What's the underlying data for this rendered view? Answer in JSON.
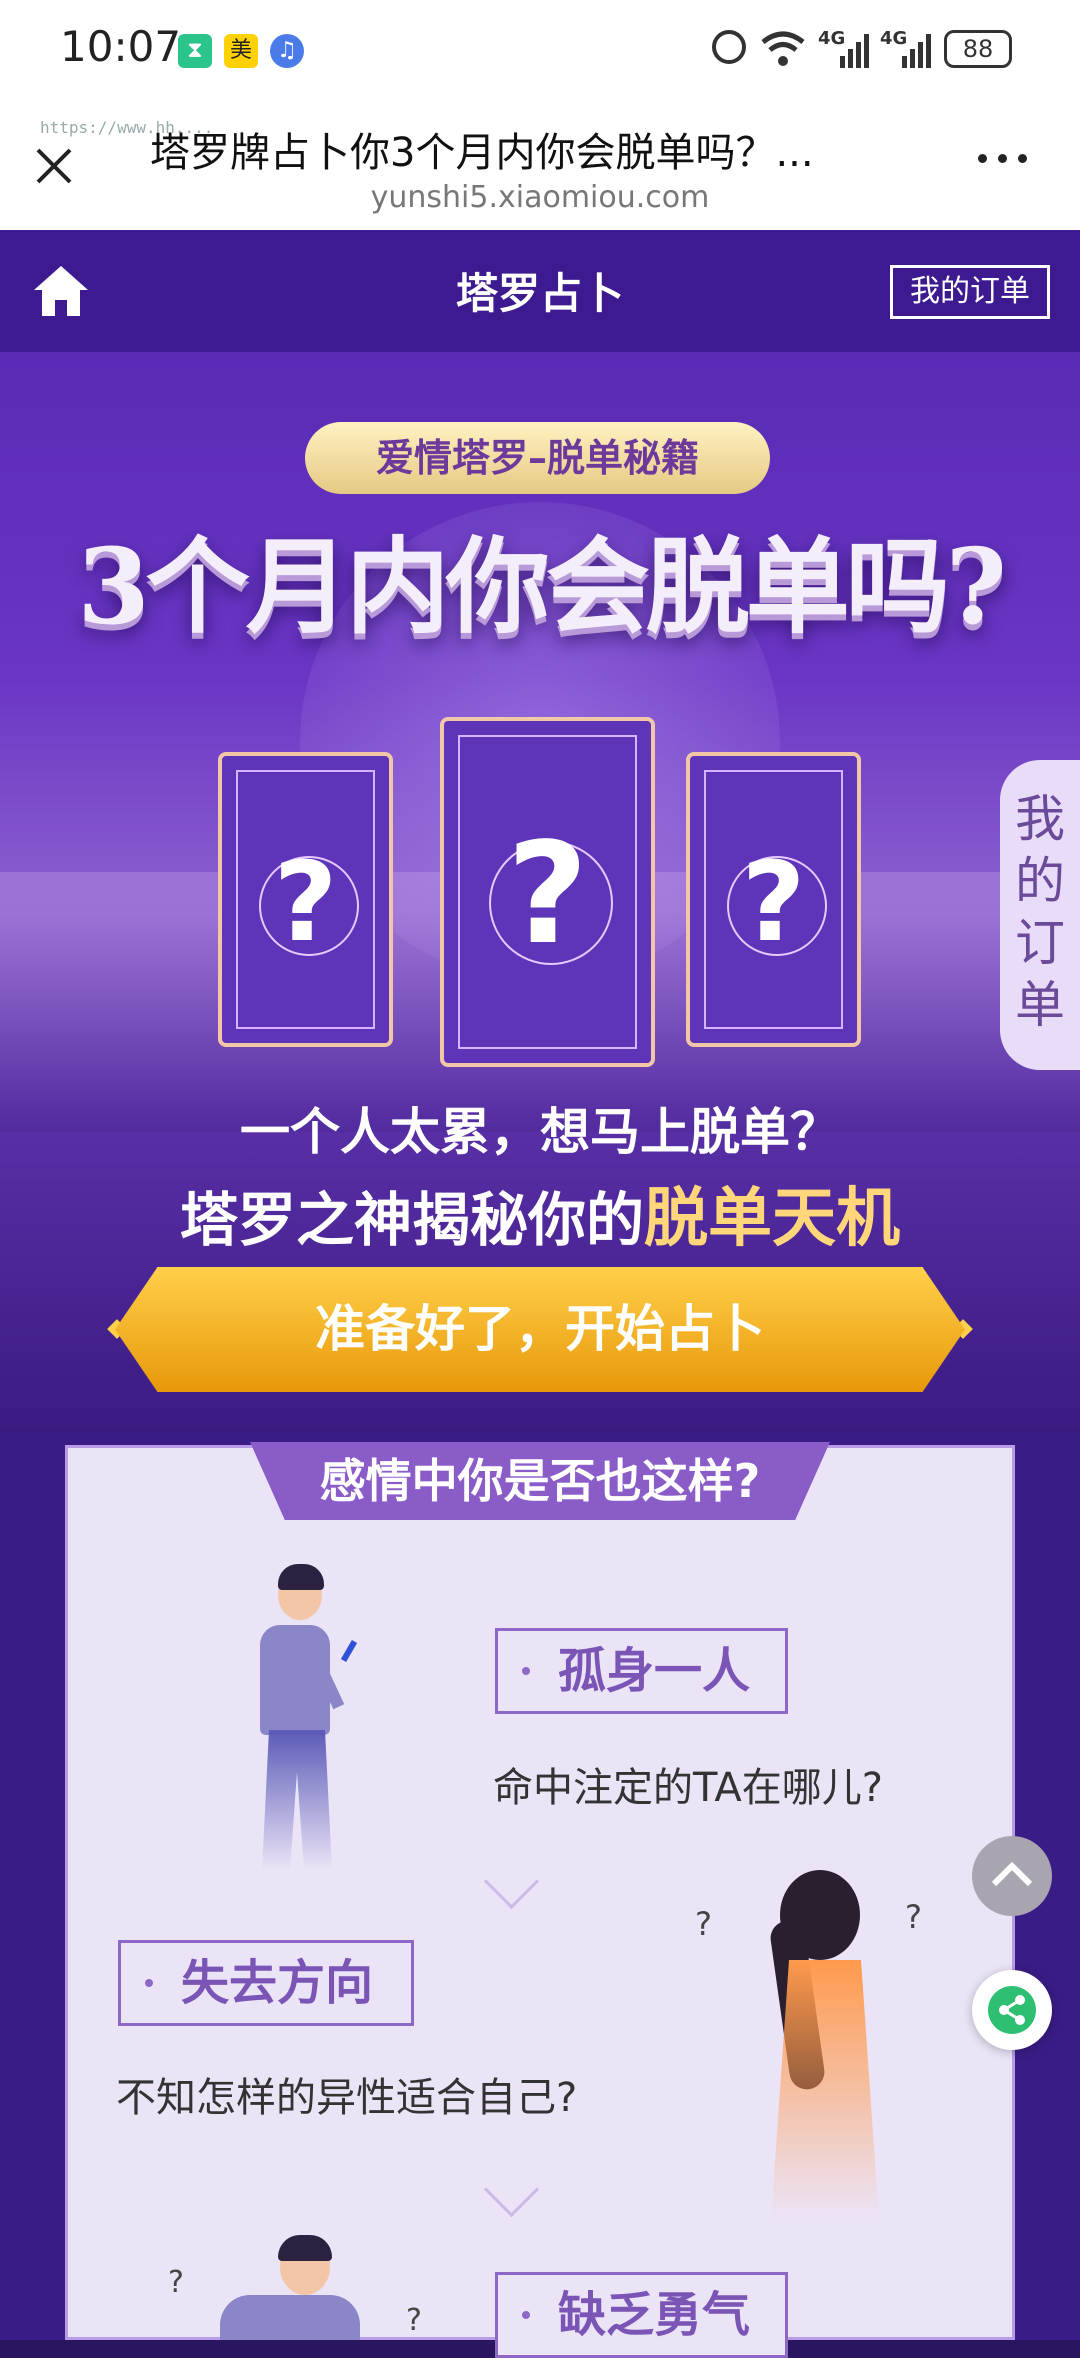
{
  "status_bar": {
    "time": "10:07",
    "app_icons": [
      "hourglass-app-icon",
      "meituan-app-icon",
      "music-app-icon"
    ],
    "meituan_label": "美",
    "network_label_1": "4G",
    "network_label_2": "4G",
    "battery": "88"
  },
  "browser": {
    "page_title": "塔罗牌占卜你3个月内你会脱单吗？...",
    "domain": "yunshi5.xiaomiou.com",
    "ghost_url": "https://www.hh...."
  },
  "nav": {
    "title": "塔罗占卜",
    "orders_button": "我的订单"
  },
  "hero": {
    "badge": "爱情塔罗–脱单秘籍",
    "headline": "3个月内你会脱单吗?",
    "card_symbol": "?",
    "line1": "一个人太累，想马上脱单？",
    "line2_prefix": "塔罗之神揭秘你的",
    "line2_highlight": "脱单天机",
    "cta": "准备好了，开始占卜"
  },
  "side_tab": {
    "label": "我的订单"
  },
  "section": {
    "title": "感情中你是否也这样?",
    "items": [
      {
        "tag": "孤身一人",
        "desc": "命中注定的TA在哪儿?"
      },
      {
        "tag": "失去方向",
        "desc": "不知怎样的异性适合自己?"
      },
      {
        "tag": "缺乏勇气",
        "desc": ""
      }
    ],
    "question_mark": "?"
  },
  "floating": {
    "top_icon": "chevron-up-icon",
    "share_icon": "share-icon"
  },
  "colors": {
    "nav_bg": "#3d1a8f",
    "accent_gold": "#ffd77a",
    "cta_orange": "#e8980a",
    "panel_bg": "#ebe4f7",
    "tag_purple": "#8d68c6"
  }
}
